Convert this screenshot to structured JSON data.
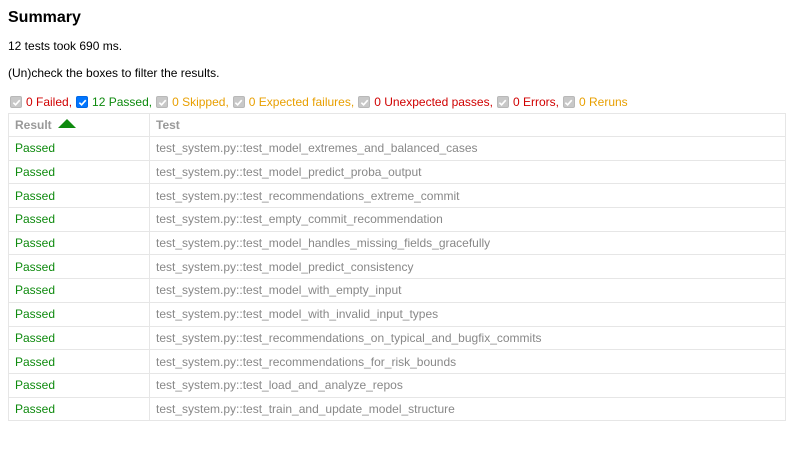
{
  "summary": {
    "title": "Summary",
    "duration_text": "12 tests took 690 ms.",
    "filter_hint": "(Un)check the boxes to filter the results."
  },
  "filters": [
    {
      "label": "0 Failed,",
      "checked": false,
      "disabled": true,
      "color": "#d00000"
    },
    {
      "label": "12 Passed,",
      "checked": true,
      "disabled": false,
      "color": "#0e8a0e"
    },
    {
      "label": "0 Skipped,",
      "checked": false,
      "disabled": true,
      "color": "#e89f00"
    },
    {
      "label": "0 Expected failures,",
      "checked": false,
      "disabled": true,
      "color": "#e89f00"
    },
    {
      "label": "0 Unexpected passes,",
      "checked": false,
      "disabled": true,
      "color": "#d00000"
    },
    {
      "label": "0 Errors,",
      "checked": false,
      "disabled": true,
      "color": "#d00000"
    },
    {
      "label": "0 Reruns",
      "checked": false,
      "disabled": true,
      "color": "#e89f00"
    }
  ],
  "table": {
    "headers": {
      "result": "Result",
      "test": "Test"
    },
    "rows": [
      {
        "result": "Passed",
        "test": "test_system.py::test_model_extremes_and_balanced_cases"
      },
      {
        "result": "Passed",
        "test": "test_system.py::test_model_predict_proba_output"
      },
      {
        "result": "Passed",
        "test": "test_system.py::test_recommendations_extreme_commit"
      },
      {
        "result": "Passed",
        "test": "test_system.py::test_empty_commit_recommendation"
      },
      {
        "result": "Passed",
        "test": "test_system.py::test_model_handles_missing_fields_gracefully"
      },
      {
        "result": "Passed",
        "test": "test_system.py::test_model_predict_consistency"
      },
      {
        "result": "Passed",
        "test": "test_system.py::test_model_with_empty_input"
      },
      {
        "result": "Passed",
        "test": "test_system.py::test_model_with_invalid_input_types"
      },
      {
        "result": "Passed",
        "test": "test_system.py::test_recommendations_on_typical_and_bugfix_commits"
      },
      {
        "result": "Passed",
        "test": "test_system.py::test_recommendations_for_risk_bounds"
      },
      {
        "result": "Passed",
        "test": "test_system.py::test_load_and_analyze_repos"
      },
      {
        "result": "Passed",
        "test": "test_system.py::test_train_and_update_model_structure"
      }
    ]
  },
  "icons": {
    "sort": "sort-ascending-icon",
    "check": "checkmark-icon"
  }
}
